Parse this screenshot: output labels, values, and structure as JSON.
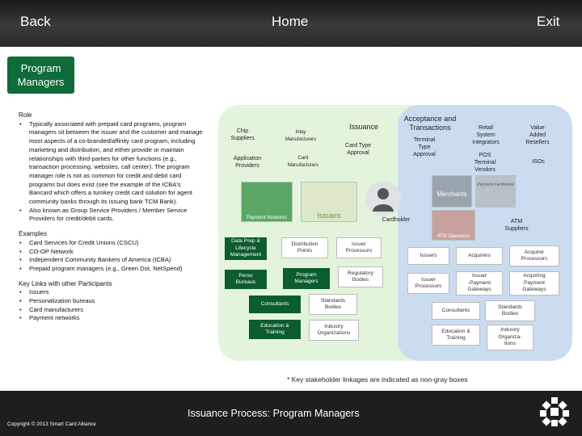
{
  "nav": {
    "back": "Back",
    "home": "Home",
    "exit": "Exit"
  },
  "section_title": [
    "Program",
    "Managers"
  ],
  "role": {
    "heading": "Role",
    "bullets": [
      "Typically associated with prepaid card programs, program managers sit between the issuer and the customer and manage most aspects of a co-branded/affinity card program, including marketing and distribution, and either provide or maintain relationships with third-parties for other functions (e.g., transaction processing, websites, call center). The program manager role is not as common for credit and debit card programs but does exist (see the example of the ICBA's Bancard which offers a turnkey credit card solution for agent community banks through its issuing bank TCM Bank).",
      "Also known as Group Service Providers / Member Service Providers for credit/debit cards."
    ]
  },
  "examples": {
    "heading": "Examples",
    "bullets": [
      "Card Services for Credit Unions (CSCU)",
      "CO-OP Network",
      "Independent Community Bankers of America (ICBA)",
      "Prepaid program managers (e.g., Green Dot, NetSpend)"
    ]
  },
  "links": {
    "heading": "Key Links with other Participants",
    "bullets": [
      "Issuers",
      "Personalization bureaus",
      "Card manufacturers",
      "Payment networks"
    ]
  },
  "diagram": {
    "issuance_title": "Issuance",
    "acceptance_title": [
      "Acceptance and",
      "Transactions"
    ],
    "issuance_labels": {
      "chip": [
        "Chip",
        "Suppliers"
      ],
      "inlay": [
        "Inlay",
        "Manufacturers"
      ],
      "card_type": [
        "Card Type",
        "Approval"
      ],
      "app_providers": [
        "Application",
        "Providers"
      ],
      "card_mfr": [
        "Card",
        "Manufacturers"
      ]
    },
    "acceptance_labels": {
      "terminal_type": [
        "Terminal",
        "Type",
        "Approval"
      ],
      "retail": [
        "Retail",
        "System",
        "Integrators"
      ],
      "var": [
        "Value",
        "Added",
        "Resellers"
      ],
      "pos": [
        "POS",
        "Terminal",
        "Vendors"
      ],
      "isos": "ISOs",
      "atm": [
        "ATM",
        "Suppliers"
      ]
    },
    "tiles": {
      "payment_networks": "Payment Networks",
      "issuers": "Issuers",
      "merchants": "Merchants",
      "atm_operators": "ATM Operators",
      "payment_facilitators": "Payment Facilitators"
    },
    "cardholder": "Cardholder",
    "green_boxes": {
      "data_prep": [
        "Data Prep &",
        "Lifecycle",
        "Management"
      ],
      "perso": [
        "Perso",
        "Bureaus"
      ],
      "program_managers": [
        "Program",
        "Managers"
      ],
      "consultants": "Consultants",
      "education": [
        "Education &",
        "Training"
      ]
    },
    "light_boxes": {
      "distribution": [
        "Distribution",
        "Points"
      ],
      "issuer_processors": [
        "Issuer",
        "Processors"
      ],
      "regulatory": [
        "Regulatory",
        "Bodies"
      ],
      "standards": [
        "Standards",
        "Bodies"
      ],
      "industry": [
        "Industry",
        "Organizations"
      ]
    },
    "blue_labels": {
      "issuers": "Issuers",
      "acquirers": "Acquirers",
      "acq_processors": [
        "Acquirer",
        "Processors"
      ],
      "issuer_processors": [
        "Issuer",
        "Processors"
      ],
      "issuer_gateways": [
        "Issuer",
        "-Payment",
        "Gateways"
      ],
      "acq_gateways": [
        "Acquiring",
        "Payment",
        "Gateways"
      ],
      "consultants": "Consultants",
      "standards": [
        "Standards",
        "Bodies"
      ],
      "education": [
        "Education &",
        "Training"
      ],
      "industry": [
        "Industry",
        "Organiza-",
        "tions"
      ]
    }
  },
  "footnote": "* Key stakeholder linkages are indicated as non-gray boxes",
  "footer": {
    "title": "Issuance Process:  Program Managers",
    "copyright": "Copyright © 2013 Smart Card Alliance"
  },
  "colors": {
    "header": "#2a2a2a",
    "accent_green": "#0b5c2e",
    "issuance_bg": "#e4f4dc",
    "acceptance_bg": "#cbdcf0"
  }
}
